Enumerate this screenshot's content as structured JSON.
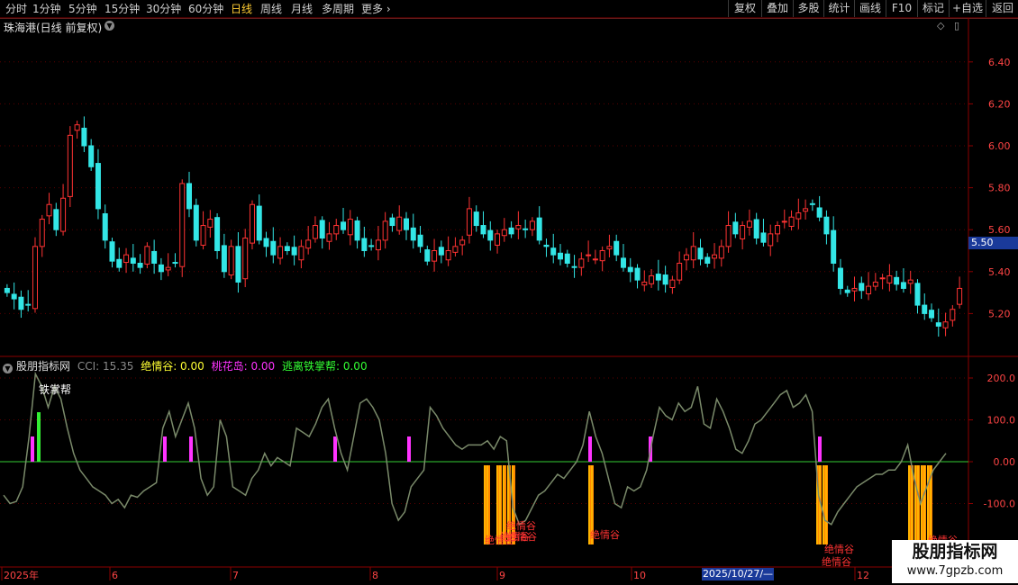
{
  "toolbar": {
    "periods": [
      "分时",
      "1分钟",
      "5分钟",
      "15分钟",
      "30分钟",
      "60分钟",
      "日线",
      "周线",
      "月线",
      "多周期",
      "更多"
    ],
    "active_period": "日线",
    "tools": [
      "复权",
      "叠加",
      "多股",
      "统计",
      "画线",
      "F10",
      "标记",
      "+自选",
      "返回"
    ]
  },
  "main_chart": {
    "title": "珠海港(日线 前复权)",
    "y_ticks": [
      "6.40",
      "6.20",
      "6.00",
      "5.80",
      "5.60",
      "5.40",
      "5.20"
    ],
    "current_price": "5.50"
  },
  "indicator": {
    "name": "股朋指标网",
    "readouts": [
      {
        "label": "CCI: 15.35",
        "color": "#8a8a8a"
      },
      {
        "label": "绝情谷: 0.00",
        "color": "#ffff33"
      },
      {
        "label": "桃花岛: 0.00",
        "color": "#ff33ff"
      },
      {
        "label": "逃离铁掌帮: 0.00",
        "color": "#33ff33"
      }
    ],
    "y_ticks": [
      "200.0",
      "100.0",
      "0.00",
      "-100.0"
    ],
    "annot_tiezhangbang": "铁掌帮",
    "annot_jueqinggu": "绝情谷"
  },
  "x_axis": {
    "labels": [
      "2025年",
      "6",
      "7",
      "8",
      "9",
      "10",
      "12"
    ],
    "cursor_date": "2025/10/27/—"
  },
  "watermark": {
    "line1": "股朋指标网",
    "line2": "www.7gpzb.com"
  },
  "colors": {
    "up": "#ff3333",
    "down": "#33e6e6",
    "grid": "#8b0000",
    "cci": "#7a8a6a",
    "zero": "#33cc33",
    "magenta": "#ff33ff",
    "orange": "#ff8800"
  },
  "chart_data": {
    "type": "candlestick",
    "closes": [
      5.3,
      5.27,
      5.22,
      5.24,
      5.52,
      5.65,
      5.72,
      5.6,
      5.75,
      6.05,
      6.1,
      6.0,
      5.9,
      5.7,
      5.55,
      5.45,
      5.42,
      5.48,
      5.44,
      5.42,
      5.52,
      5.44,
      5.4,
      5.42,
      5.44,
      5.82,
      5.7,
      5.55,
      5.62,
      5.65,
      5.5,
      5.4,
      5.52,
      5.35,
      5.56,
      5.72,
      5.55,
      5.52,
      5.48,
      5.52,
      5.5,
      5.48,
      5.52,
      5.55,
      5.62,
      5.56,
      5.58,
      5.62,
      5.6,
      5.65,
      5.55,
      5.5,
      5.52,
      5.55,
      5.64,
      5.62,
      5.66,
      5.6,
      5.55,
      5.52,
      5.45,
      5.5,
      5.48,
      5.5,
      5.52,
      5.55,
      5.7,
      5.62,
      5.58,
      5.55,
      5.58,
      5.6,
      5.58,
      5.62,
      5.6,
      5.64,
      5.55,
      5.52,
      5.48,
      5.46,
      5.44,
      5.42,
      5.46,
      5.48,
      5.46,
      5.5,
      5.52,
      5.48,
      5.42,
      5.4,
      5.36,
      5.35,
      5.38,
      5.36,
      5.34,
      5.36,
      5.44,
      5.48,
      5.52,
      5.46,
      5.44,
      5.48,
      5.52,
      5.62,
      5.58,
      5.62,
      5.64,
      5.56,
      5.54,
      5.58,
      5.62,
      5.64,
      5.66,
      5.68,
      5.7,
      5.72,
      5.66,
      5.58,
      5.44,
      5.32,
      5.3,
      5.32,
      5.31,
      5.33,
      5.35,
      5.37,
      5.38,
      5.34,
      5.32,
      5.36,
      5.24,
      5.2,
      5.18,
      5.14,
      5.16,
      5.22,
      5.32
    ],
    "cci": [
      -80,
      -100,
      -95,
      -60,
      60,
      210,
      180,
      130,
      180,
      150,
      80,
      20,
      -20,
      -40,
      -60,
      -70,
      -80,
      -100,
      -90,
      -110,
      -80,
      -85,
      -70,
      -60,
      -50,
      80,
      120,
      60,
      100,
      140,
      80,
      -40,
      -80,
      -60,
      100,
      60,
      -60,
      -70,
      -80,
      -40,
      -20,
      20,
      -10,
      10,
      0,
      -10,
      80,
      70,
      60,
      90,
      130,
      150,
      80,
      20,
      -20,
      60,
      140,
      150,
      130,
      100,
      20,
      -100,
      -140,
      -120,
      -60,
      -40,
      -20,
      130,
      110,
      80,
      60,
      40,
      30,
      40,
      40,
      40,
      50,
      30,
      60,
      50,
      -110,
      -150,
      -140,
      -110,
      -80,
      -70,
      -50,
      -30,
      -40,
      -20,
      0,
      40,
      120,
      60,
      20,
      -40,
      -100,
      -110,
      -60,
      -70,
      -60,
      -20,
      60,
      130,
      110,
      100,
      140,
      120,
      130,
      180,
      90,
      80,
      150,
      120,
      80,
      30,
      20,
      50,
      90,
      100,
      120,
      140,
      160,
      170,
      130,
      140,
      160,
      120,
      -80,
      -140,
      -150,
      -120,
      -100,
      -80,
      -60,
      -50,
      -40,
      -30,
      -30,
      -20,
      -20,
      0,
      40,
      -40,
      -100,
      -60,
      -20,
      0,
      20
    ],
    "orange_bars": [
      [
        537,
        544
      ],
      [
        551,
        557
      ],
      [
        558,
        562
      ],
      [
        563,
        567
      ],
      [
        568,
        572
      ],
      [
        653,
        659
      ],
      [
        906,
        912
      ],
      [
        913,
        919
      ],
      [
        1008,
        1014
      ],
      [
        1015,
        1021
      ],
      [
        1022,
        1028
      ],
      [
        1029,
        1035
      ]
    ],
    "magenta_bars": [
      36,
      183,
      212,
      372,
      454,
      655,
      722,
      910
    ],
    "green_bars": [
      43
    ]
  }
}
